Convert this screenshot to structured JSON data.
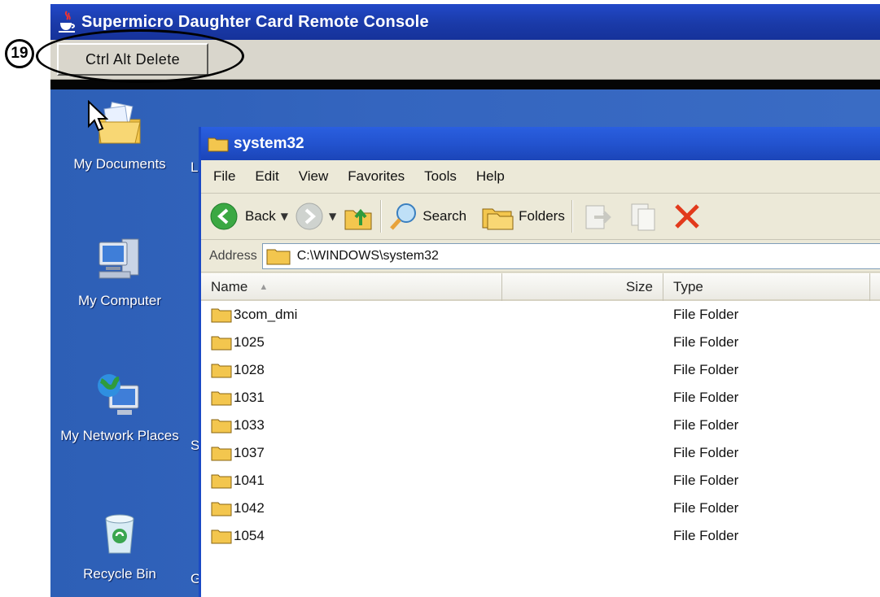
{
  "callout": {
    "number": "19"
  },
  "console": {
    "title": "Supermicro Daughter Card Remote Console",
    "cad_button": "Ctrl Alt Delete"
  },
  "desktop": {
    "icons": [
      {
        "label": "My Documents",
        "icon": "my-documents-icon"
      },
      {
        "label": "My Computer",
        "icon": "my-computer-icon"
      },
      {
        "label": "My Network Places",
        "icon": "my-network-places-icon"
      },
      {
        "label": "Recycle Bin",
        "icon": "recycle-bin-icon"
      }
    ],
    "side_letters": [
      "L",
      "S",
      "G"
    ]
  },
  "explorer": {
    "title": "system32",
    "menu": [
      "File",
      "Edit",
      "View",
      "Favorites",
      "Tools",
      "Help"
    ],
    "toolbar": {
      "back": "Back",
      "search": "Search",
      "folders": "Folders"
    },
    "address": {
      "label": "Address",
      "value": "C:\\WINDOWS\\system32"
    },
    "columns": {
      "name": "Name",
      "size": "Size",
      "type": "Type"
    },
    "rows": [
      {
        "name": "3com_dmi",
        "type": "File Folder"
      },
      {
        "name": "1025",
        "type": "File Folder"
      },
      {
        "name": "1028",
        "type": "File Folder"
      },
      {
        "name": "1031",
        "type": "File Folder"
      },
      {
        "name": "1033",
        "type": "File Folder"
      },
      {
        "name": "1037",
        "type": "File Folder"
      },
      {
        "name": "1041",
        "type": "File Folder"
      },
      {
        "name": "1042",
        "type": "File Folder"
      },
      {
        "name": "1054",
        "type": "File Folder"
      }
    ]
  },
  "colors": {
    "desktop_blue": "#3465bf",
    "titlebar_blue": "#2353cf",
    "folder_yellow": "#f3c64e",
    "delete_red": "#e23a1c"
  }
}
